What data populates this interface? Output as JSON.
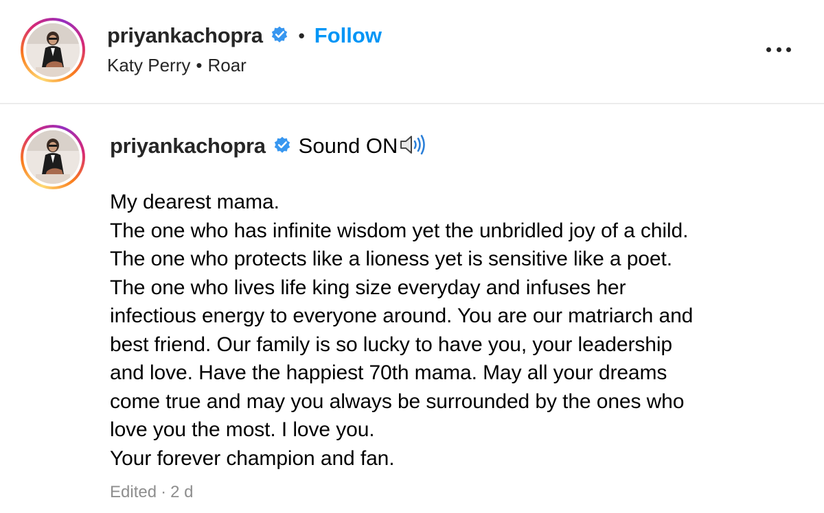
{
  "header": {
    "username": "priyankachopra",
    "separator": "•",
    "follow_label": "Follow",
    "audio": {
      "artist": "Katy Perry",
      "separator": "•",
      "track": "Roar"
    },
    "more_icon": "more-horizontal-icon"
  },
  "caption": {
    "username": "priyankachopra",
    "sound_text": "Sound ON",
    "sound_icon": "speaker-volume-icon",
    "lines": [
      "My dearest mama.",
      "The one who has infinite wisdom yet the unbridled joy of a child.",
      "The one who protects like a lioness yet is sensitive like a poet.",
      "The one who lives life king size everyday and infuses her",
      "infectious energy to everyone around. You are our matriarch and",
      "best friend. Our family is so lucky to have you, your leadership",
      "and love. Have the happiest 70th mama. May all your dreams",
      "come true and may you always be surrounded by the ones who",
      "love you the most. I love you.",
      "Your forever champion and fan."
    ],
    "edited_label": "Edited",
    "meta_separator": "·",
    "time_ago": "2 d"
  },
  "colors": {
    "verified_badge": "#3897f0",
    "follow_blue": "#0095f6",
    "meta_gray": "#8e8e8e",
    "ring_gradient": [
      "#feda75",
      "#fa7e1e",
      "#d62976",
      "#962fbf"
    ]
  }
}
